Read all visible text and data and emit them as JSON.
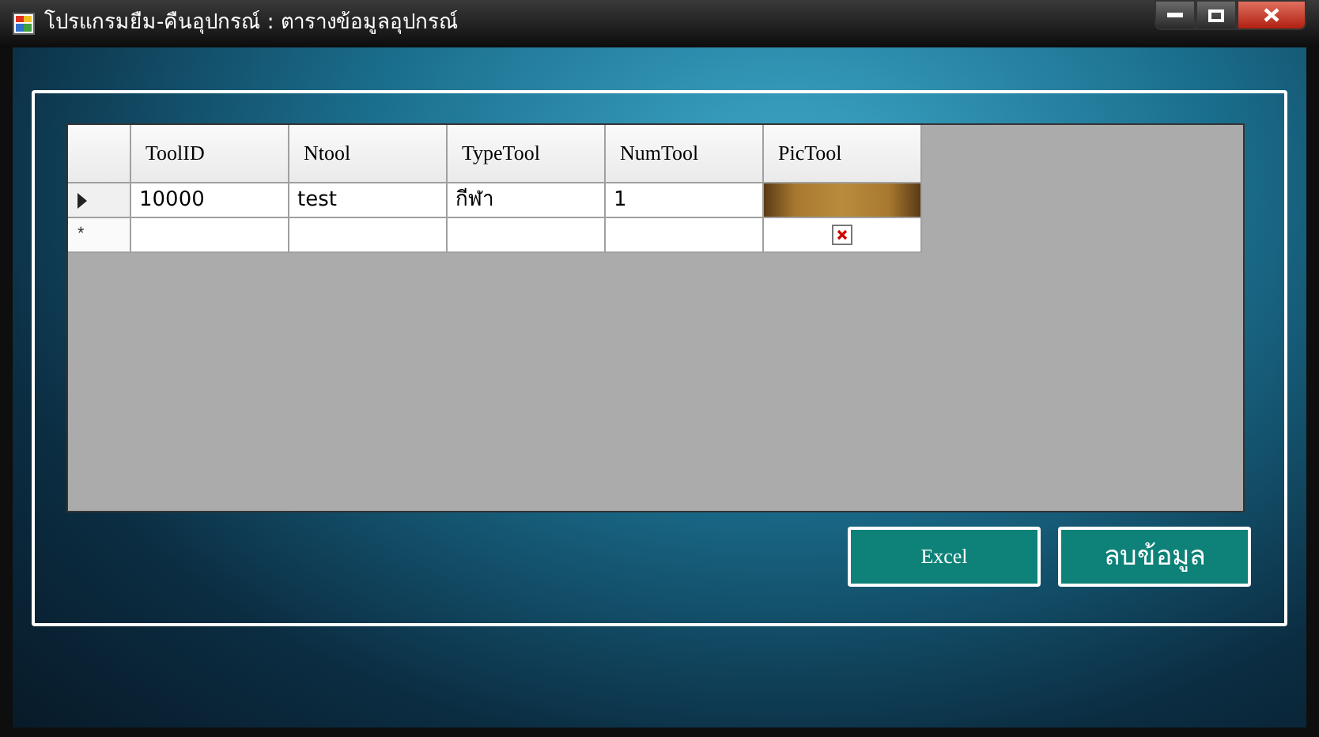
{
  "window": {
    "title": "โปรแกรมยืม-คืนอุปกรณ์ : ตารางข้อมูลอุปกรณ์"
  },
  "grid": {
    "columns": [
      "ToolID",
      "Ntool",
      "TypeTool",
      "NumTool",
      "PicTool"
    ],
    "rows": [
      {
        "kind": "data",
        "current": true,
        "cells": [
          "10000",
          "test",
          "กีฬา",
          "1"
        ],
        "picture": {
          "kind": "photo"
        }
      },
      {
        "kind": "new",
        "current": false,
        "marker": "*",
        "picture": {
          "kind": "missing"
        }
      }
    ]
  },
  "buttons": [
    "Excel",
    "ลบข้อมูล"
  ]
}
